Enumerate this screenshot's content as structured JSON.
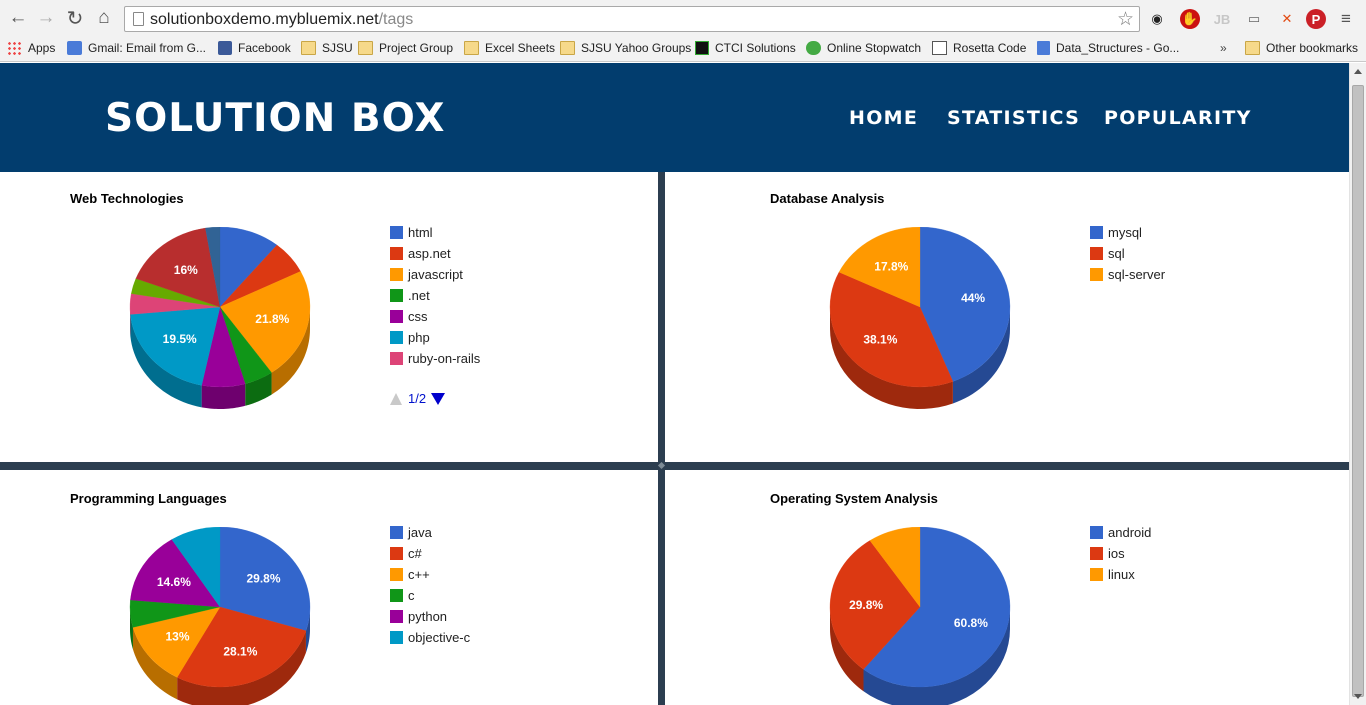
{
  "browser": {
    "url_host": "solutionboxdemo.mybluemix.net",
    "url_path": "/tags",
    "bookmarks": [
      {
        "label": "Apps",
        "icon": "apps-grid-icon"
      },
      {
        "label": "Gmail: Email from G...",
        "icon": "google-icon"
      },
      {
        "label": "Facebook",
        "icon": "facebook-icon"
      },
      {
        "label": "SJSU",
        "icon": "folder-icon"
      },
      {
        "label": "Project Group",
        "icon": "folder-icon"
      },
      {
        "label": "Excel Sheets",
        "icon": "folder-icon"
      },
      {
        "label": "SJSU Yahoo Groups",
        "icon": "folder-icon"
      },
      {
        "label": "CTCI Solutions",
        "icon": "terminal-icon"
      },
      {
        "label": "Online Stopwatch",
        "icon": "stopwatch-icon"
      },
      {
        "label": "Rosetta Code",
        "icon": "rosetta-icon"
      },
      {
        "label": "Data_Structures - Go...",
        "icon": "doc-icon"
      }
    ],
    "overflow_label": "»",
    "other_bookmarks": "Other bookmarks"
  },
  "header": {
    "logo": "SOLUTION BOX",
    "nav": [
      "HOME",
      "STATISTICS",
      "POPULARITY"
    ],
    "bg_color": "#023d6e"
  },
  "pager": {
    "text": "1/2"
  },
  "chart_data": [
    {
      "type": "pie",
      "title": "Web Technologies",
      "categories": [
        "html",
        "asp.net",
        "javascript",
        ".net",
        "css",
        "php",
        "ruby-on-rails",
        "",
        "",
        ""
      ],
      "values": [
        10.5,
        6.5,
        21.8,
        5.0,
        7.5,
        19.5,
        4.0,
        3.0,
        16.0,
        2.5
      ],
      "colors": [
        "#3366cc",
        "#dc3912",
        "#ff9900",
        "#109618",
        "#990099",
        "#0099c6",
        "#dd4477",
        "#66aa00",
        "#b82e2e",
        "#316395"
      ],
      "labels": {
        "2": "21.8%",
        "5": "19.5%",
        "8": "16%"
      },
      "legend": [
        "html",
        "asp.net",
        "javascript",
        ".net",
        "css",
        "php",
        "ruby-on-rails"
      ],
      "legend_placement": "right",
      "style": "3d"
    },
    {
      "type": "pie",
      "title": "Database Analysis",
      "categories": [
        "mysql",
        "sql",
        "sql-server"
      ],
      "values": [
        44,
        38.1,
        17.8
      ],
      "colors": [
        "#3366cc",
        "#dc3912",
        "#ff9900"
      ],
      "labels": {
        "0": "44%",
        "1": "38.1%",
        "2": "17.8%"
      },
      "legend": [
        "mysql",
        "sql",
        "sql-server"
      ],
      "legend_placement": "right",
      "style": "3d"
    },
    {
      "type": "pie",
      "title": "Programming Languages",
      "categories": [
        "java",
        "c#",
        "c++",
        "c",
        "python",
        "objective-c"
      ],
      "values": [
        29.8,
        28.1,
        13.0,
        5.5,
        14.6,
        9.0
      ],
      "colors": [
        "#3366cc",
        "#dc3912",
        "#ff9900",
        "#109618",
        "#990099",
        "#0099c6"
      ],
      "labels": {
        "0": "29.8%",
        "1": "28.1%",
        "2": "13%",
        "4": "14.6%"
      },
      "legend": [
        "java",
        "c#",
        "c++",
        "c",
        "python",
        "objective-c"
      ],
      "legend_placement": "right",
      "style": "3d"
    },
    {
      "type": "pie",
      "title": "Operating System Analysis",
      "categories": [
        "android",
        "ios",
        "linux"
      ],
      "values": [
        60.8,
        29.8,
        9.4
      ],
      "colors": [
        "#3366cc",
        "#dc3912",
        "#ff9900"
      ],
      "labels": {
        "0": "60.8%",
        "1": "29.8%"
      },
      "legend": [
        "android",
        "ios",
        "linux"
      ],
      "legend_placement": "right",
      "style": "3d"
    }
  ]
}
